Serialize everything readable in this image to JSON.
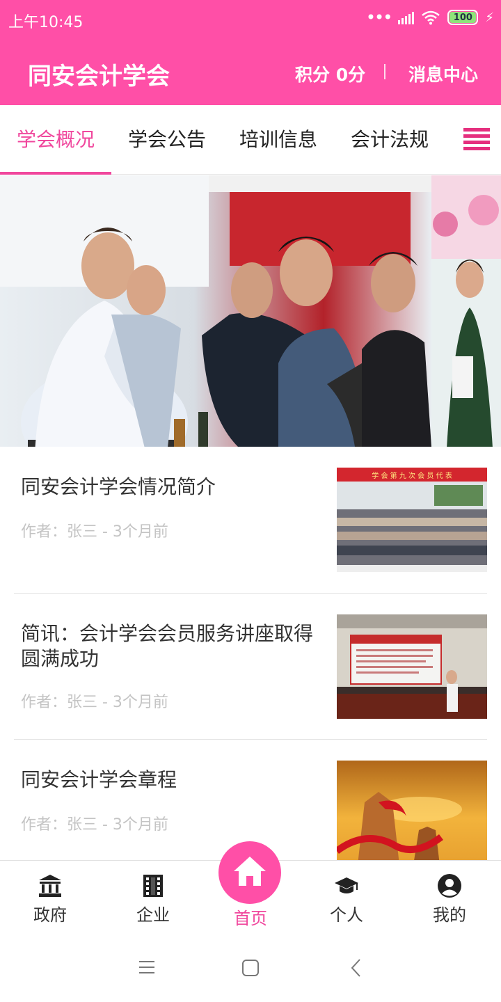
{
  "status_bar": {
    "time": "上午10:45",
    "battery": "100"
  },
  "header": {
    "title": "同安会计学会",
    "points": "积分 0分",
    "message_center": "消息中心"
  },
  "tabs": [
    {
      "label": "学会概况",
      "active": true
    },
    {
      "label": "学会公告",
      "active": false
    },
    {
      "label": "培训信息",
      "active": false
    },
    {
      "label": "会计法规",
      "active": false
    }
  ],
  "banner": {
    "slides": 4,
    "active_index": 0
  },
  "articles": [
    {
      "title": "同安会计学会情况简介",
      "meta": "作者：张三 - 3个月前",
      "thumb_caption": "学 会 第 九 次 会 员 代 表"
    },
    {
      "title": "简讯：会计学会会员服务讲座取得圆满成功",
      "meta": "作者：张三 - 3个月前"
    },
    {
      "title": "同安会计学会章程",
      "meta": "作者：张三 - 3个月前"
    }
  ],
  "bottom_nav": [
    {
      "label": "政府",
      "icon": "bank-icon"
    },
    {
      "label": "企业",
      "icon": "building-icon"
    },
    {
      "label": "首页",
      "icon": "home-icon",
      "active": true
    },
    {
      "label": "个人",
      "icon": "graduation-cap-icon"
    },
    {
      "label": "我的",
      "icon": "user-circle-icon"
    }
  ],
  "colors": {
    "primary": "#ff4fa7",
    "accent_text": "#f0479d",
    "menu_icon": "#e52f7e",
    "meta_text": "#c4c4c4"
  }
}
